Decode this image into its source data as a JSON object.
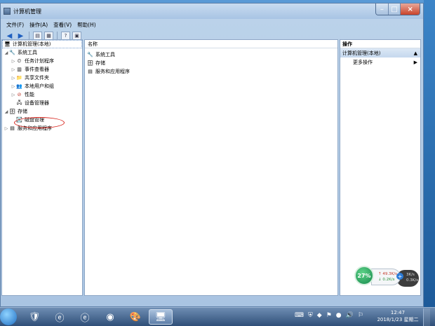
{
  "window": {
    "title": "计算机管理"
  },
  "menubar": [
    "文件(F)",
    "操作(A)",
    "查看(V)",
    "帮助(H)"
  ],
  "tree": {
    "root": "计算机管理(本地)",
    "system_tools": "系统工具",
    "task_scheduler": "任务计划程序",
    "event_viewer": "事件查看器",
    "shared_folders": "共享文件夹",
    "local_users": "本地用户和组",
    "performance": "性能",
    "device_manager": "设备管理器",
    "storage": "存储",
    "disk_management": "磁盘管理",
    "services_apps": "服务和应用程序"
  },
  "middle": {
    "column_header": "名称",
    "items": [
      "系统工具",
      "存储",
      "服务和应用程序"
    ]
  },
  "actions": {
    "header": "操作",
    "section": "计算机管理(本地)",
    "more": "更多操作"
  },
  "net_monitor": {
    "percent": "27%",
    "upload": "49.3K/s",
    "download": "0.2K/s",
    "extra1": "3K/s",
    "extra2": "0.3K/s"
  },
  "clock": {
    "time": "12:47",
    "date": "2018/1/23 星期二"
  }
}
